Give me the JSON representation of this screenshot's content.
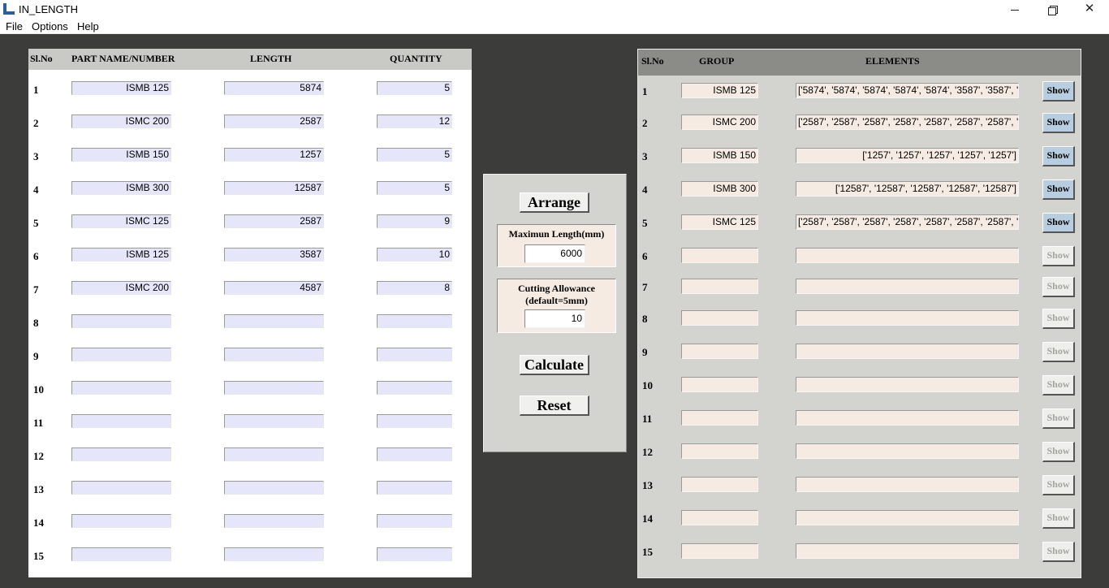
{
  "window": {
    "title": "IN_LENGTH",
    "minimize": "—",
    "close": "✕"
  },
  "menu": [
    "File",
    "Options",
    "Help"
  ],
  "left": {
    "headers": {
      "sl": "Sl.No",
      "part": "PART NAME/NUMBER",
      "length": "LENGTH",
      "quantity": "QUANTITY"
    },
    "rows": [
      {
        "sl": "1",
        "part": "ISMB 125",
        "length": "5874",
        "quantity": "5"
      },
      {
        "sl": "2",
        "part": "ISMC 200",
        "length": "2587",
        "quantity": "12"
      },
      {
        "sl": "3",
        "part": "ISMB 150",
        "length": "1257",
        "quantity": "5"
      },
      {
        "sl": "4",
        "part": "ISMB 300",
        "length": "12587",
        "quantity": "5"
      },
      {
        "sl": "5",
        "part": "ISMC 125",
        "length": "2587",
        "quantity": "9"
      },
      {
        "sl": "6",
        "part": "ISMB 125",
        "length": "3587",
        "quantity": "10"
      },
      {
        "sl": "7",
        "part": "ISMC 200",
        "length": "4587",
        "quantity": "8"
      },
      {
        "sl": "8",
        "part": "",
        "length": "",
        "quantity": ""
      },
      {
        "sl": "9",
        "part": "",
        "length": "",
        "quantity": ""
      },
      {
        "sl": "10",
        "part": "",
        "length": "",
        "quantity": ""
      },
      {
        "sl": "11",
        "part": "",
        "length": "",
        "quantity": ""
      },
      {
        "sl": "12",
        "part": "",
        "length": "",
        "quantity": ""
      },
      {
        "sl": "13",
        "part": "",
        "length": "",
        "quantity": ""
      },
      {
        "sl": "14",
        "part": "",
        "length": "",
        "quantity": ""
      },
      {
        "sl": "15",
        "part": "",
        "length": "",
        "quantity": ""
      }
    ]
  },
  "middle": {
    "arrange": "Arrange",
    "max_length_label": "Maximun Length(mm)",
    "max_length_value": "6000",
    "cutting_label_1": "Cutting Allowance",
    "cutting_label_2": "(default=5mm)",
    "cutting_value": "10",
    "calculate": "Calculate",
    "reset": "Reset"
  },
  "right": {
    "headers": {
      "sl": "Sl.No",
      "group": "GROUP",
      "elements": "ELEMENTS"
    },
    "show_label": "Show",
    "rows": [
      {
        "sl": "1",
        "group": "ISMB 125",
        "elements": "['5874', '5874', '5874', '5874', '5874', '3587', '3587', '35",
        "active": true,
        "clip": true
      },
      {
        "sl": "2",
        "group": "ISMC 200",
        "elements": "['2587', '2587', '2587', '2587', '2587', '2587', '2587', '25",
        "active": true,
        "clip": true
      },
      {
        "sl": "3",
        "group": "ISMB 150",
        "elements": "['1257', '1257', '1257', '1257', '1257']",
        "active": true,
        "clip": false
      },
      {
        "sl": "4",
        "group": "ISMB 300",
        "elements": "['12587', '12587', '12587', '12587', '12587']",
        "active": true,
        "clip": false
      },
      {
        "sl": "5",
        "group": "ISMC 125",
        "elements": "['2587', '2587', '2587', '2587', '2587', '2587', '2587', '25",
        "active": true,
        "clip": true
      },
      {
        "sl": "6",
        "group": "",
        "elements": "",
        "active": false,
        "clip": false
      },
      {
        "sl": "7",
        "group": "",
        "elements": "",
        "active": false,
        "clip": false
      },
      {
        "sl": "8",
        "group": "",
        "elements": "",
        "active": false,
        "clip": false
      },
      {
        "sl": "9",
        "group": "",
        "elements": "",
        "active": false,
        "clip": false
      },
      {
        "sl": "10",
        "group": "",
        "elements": "",
        "active": false,
        "clip": false
      },
      {
        "sl": "11",
        "group": "",
        "elements": "",
        "active": false,
        "clip": false
      },
      {
        "sl": "12",
        "group": "",
        "elements": "",
        "active": false,
        "clip": false
      },
      {
        "sl": "13",
        "group": "",
        "elements": "",
        "active": false,
        "clip": false
      },
      {
        "sl": "14",
        "group": "",
        "elements": "",
        "active": false,
        "clip": false
      },
      {
        "sl": "15",
        "group": "",
        "elements": "",
        "active": false,
        "clip": false
      }
    ]
  }
}
